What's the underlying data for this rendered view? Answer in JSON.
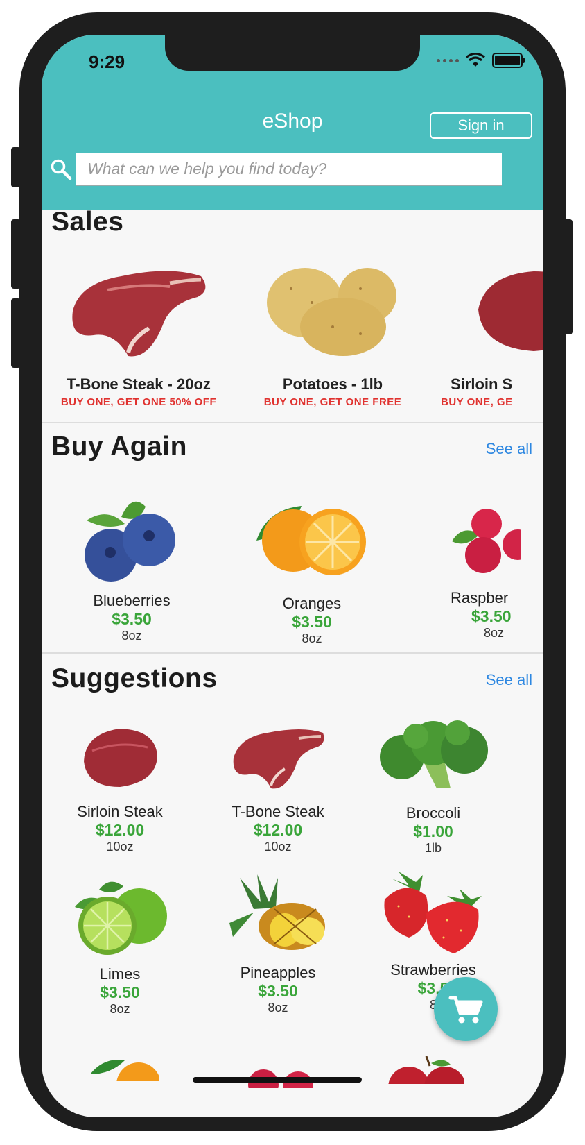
{
  "status_bar": {
    "time": "9:29"
  },
  "header": {
    "title": "eShop",
    "sign_in_label": "Sign in"
  },
  "search": {
    "placeholder": "What can we help you find today?"
  },
  "sales": {
    "title": "Sales",
    "items": [
      {
        "name": "T-Bone Steak - 20oz",
        "promo": "BUY ONE, GET ONE 50% OFF",
        "image": "t-bone-steak"
      },
      {
        "name": "Potatoes - 1lb",
        "promo": "BUY ONE, GET ONE FREE",
        "image": "potatoes"
      },
      {
        "name": "Sirloin S",
        "promo": "BUY ONE, GE",
        "image": "sirloin-steak"
      }
    ]
  },
  "buy_again": {
    "title": "Buy Again",
    "see_all": "See all",
    "items": [
      {
        "name": "Blueberries",
        "price": "$3.50",
        "unit": "8oz",
        "image": "blueberries"
      },
      {
        "name": "Oranges",
        "price": "$3.50",
        "unit": "8oz",
        "image": "oranges"
      },
      {
        "name": "Raspber",
        "price": "$3.50",
        "unit": "8oz",
        "image": "raspberries"
      }
    ]
  },
  "suggestions": {
    "title": "Suggestions",
    "see_all": "See all",
    "items": [
      {
        "name": "Sirloin Steak",
        "price": "$12.00",
        "unit": "10oz",
        "image": "sirloin-steak"
      },
      {
        "name": "T-Bone Steak",
        "price": "$12.00",
        "unit": "10oz",
        "image": "t-bone-steak"
      },
      {
        "name": "Broccoli",
        "price": "$1.00",
        "unit": "1lb",
        "image": "broccoli"
      },
      {
        "name": "Limes",
        "price": "$3.50",
        "unit": "8oz",
        "image": "limes"
      },
      {
        "name": "Pineapples",
        "price": "$3.50",
        "unit": "8oz",
        "image": "pineapples"
      },
      {
        "name": "Strawberries",
        "price": "$3.5",
        "unit": "8",
        "image": "strawberries"
      }
    ]
  },
  "colors": {
    "accent": "#4bbfbf",
    "price": "#3aa53a",
    "promo": "#e0322f",
    "link": "#2d87e1"
  },
  "icons": {
    "search": "search-icon",
    "cart": "cart-icon"
  }
}
